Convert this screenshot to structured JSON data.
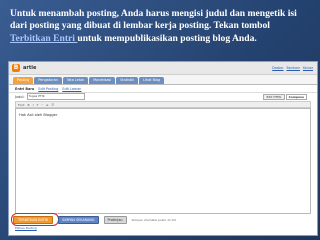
{
  "caption": {
    "part1": "Untuk menambah posting, Anda harus mengisi judul dan mengetik isi dari posting yang dibuat di lembar kerja posting. Tekan tombol ",
    "link": "Terbitkan Entri ",
    "part2": "untuk mempublikasikan posting blog Anda."
  },
  "blogger": {
    "blog_name": "artie",
    "top_links": [
      "Dasbor",
      "Bantuan",
      "Keluar"
    ],
    "tabs": [
      "Posting",
      "Pengaturan",
      "Tata Letak",
      "Monetisasi",
      "Statistik",
      "Lihat Blog"
    ],
    "subtabs": [
      "Entri Baru",
      "Edit Posting",
      "Edit Laman"
    ],
    "title_label": "Judul:",
    "title_value": "Tugas PTIK",
    "mode_html": "Edit HTML",
    "mode_compose": "Compose",
    "toolbar_glyphs": [
      "Font",
      "B",
      "I",
      "T",
      "“",
      "≡",
      "☰"
    ],
    "body_text": "Hak Asli oleh Blogger",
    "btn_publish": "TERBITKAN ENTRI",
    "btn_save": "SIMPAN SEKARANG",
    "btn_preview": "Pratinjau",
    "saved_note": "Simpan otomatis pukul 11:04",
    "post_options": "Pilihan Posting"
  },
  "colors": {
    "slide_bg": "#2c4a78",
    "accent_orange": "#f29a2e",
    "highlight_red": "#e02020"
  }
}
